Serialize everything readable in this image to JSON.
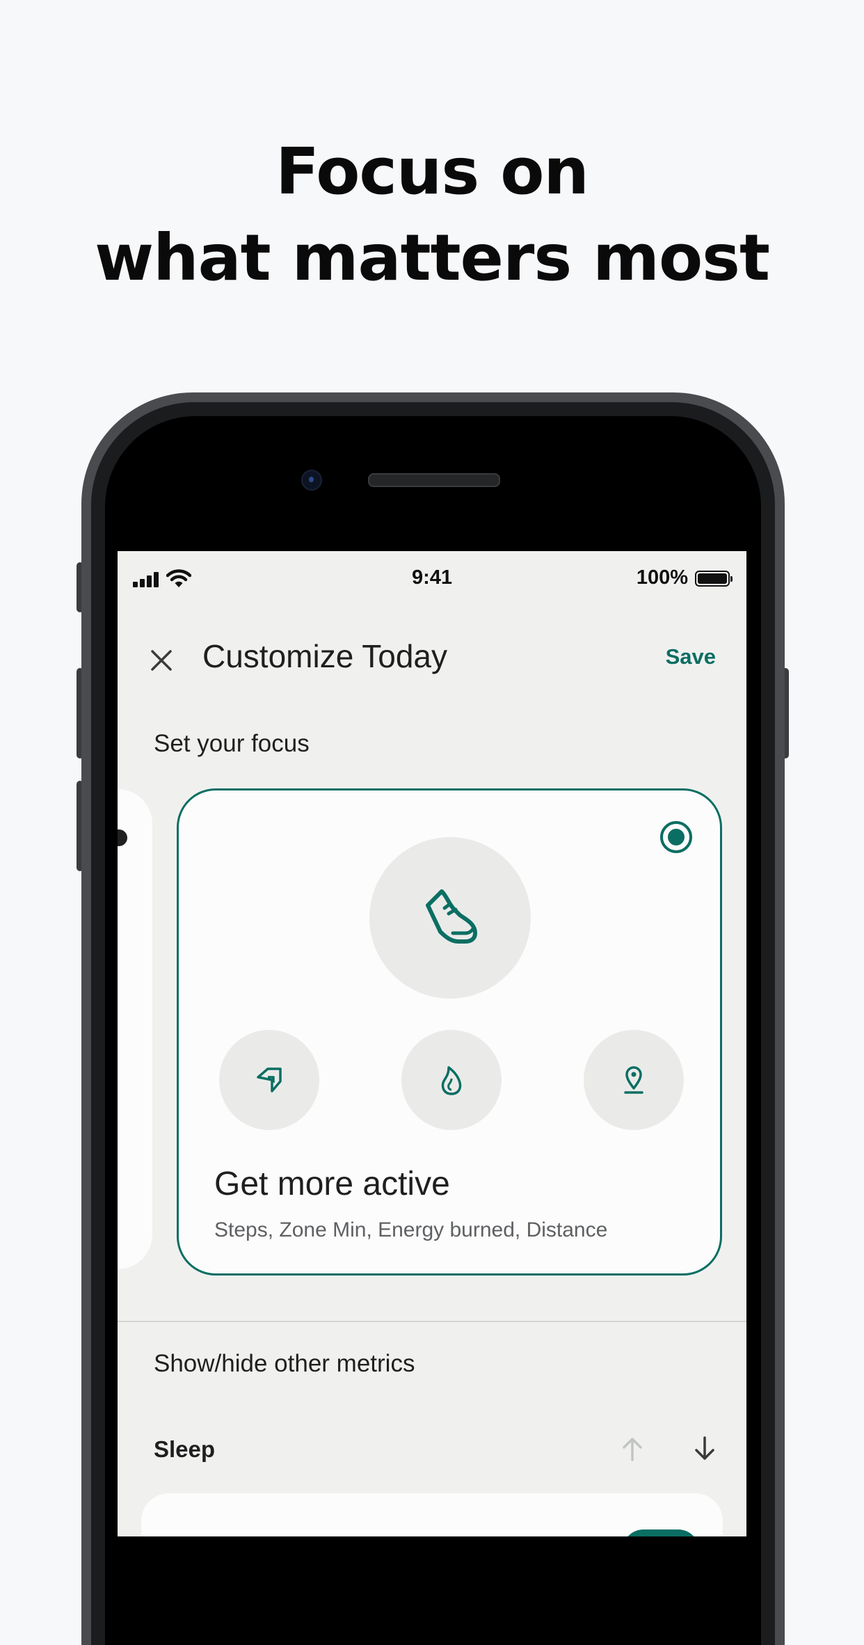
{
  "headline": {
    "line1": "Focus on",
    "line2": "what matters most"
  },
  "status_bar": {
    "time": "9:41",
    "battery": "100%",
    "icons": [
      "signal-icon",
      "wifi-icon",
      "battery-icon"
    ]
  },
  "header": {
    "close_icon": "close-icon",
    "title": "Customize Today",
    "save_label": "Save"
  },
  "focus": {
    "section_label": "Set your focus",
    "selected_card": {
      "title": "Get more active",
      "subtitle": "Steps, Zone Min, Energy burned, Distance",
      "main_icon": "shoe-icon",
      "metric_icons": [
        "zone-minutes-icon",
        "flame-icon",
        "location-pin-icon"
      ],
      "selected": true
    }
  },
  "metrics": {
    "section_label": "Show/hide other metrics",
    "items": [
      {
        "label": "Sleep",
        "move_up_icon": "arrow-up-icon",
        "move_down_icon": "arrow-down-icon"
      }
    ]
  },
  "colors": {
    "accent": "#0b6e63",
    "screen_bg": "#f0f1ef",
    "page_bg": "#f7f8fa",
    "circle_bg": "#eaebe9"
  }
}
